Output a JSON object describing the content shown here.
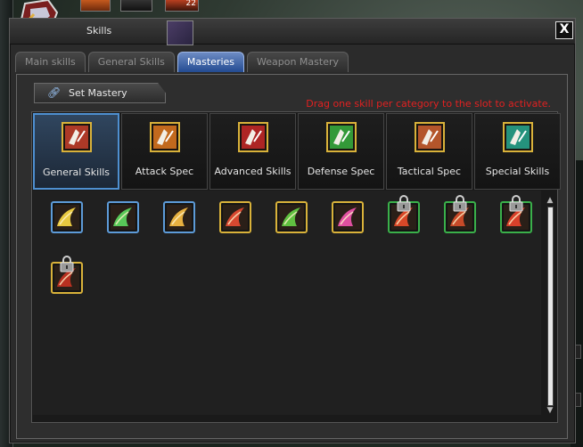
{
  "window": {
    "title": "Skills",
    "close_label": "X"
  },
  "hud": {
    "slot_badge": "22"
  },
  "tabs": [
    {
      "label": "Main skills",
      "active": false
    },
    {
      "label": "General Skills",
      "active": false
    },
    {
      "label": "Masteries",
      "active": true
    },
    {
      "label": "Weapon Mastery",
      "active": false
    }
  ],
  "panel": {
    "heading": "Set Mastery",
    "hint": "Drag one skill per category to the slot to activate."
  },
  "categories": [
    {
      "label": "General Skills",
      "active": true,
      "icon": "white-red-claw",
      "color": "#c8402c"
    },
    {
      "label": "Attack Spec",
      "active": false,
      "icon": "orange-fire-slash",
      "color": "#e07820"
    },
    {
      "label": "Advanced Skills",
      "active": false,
      "icon": "red-blade",
      "color": "#c82828"
    },
    {
      "label": "Defense Spec",
      "active": false,
      "icon": "green-swirl",
      "color": "#38b040"
    },
    {
      "label": "Tactical Spec",
      "active": false,
      "icon": "armored-figure",
      "color": "#d06030"
    },
    {
      "label": "Special Skills",
      "active": false,
      "icon": "teal-aura",
      "color": "#28a890"
    }
  ],
  "skills": [
    {
      "icon": "yellow-wing",
      "color": "#e8c840",
      "border": "blue",
      "locked": false
    },
    {
      "icon": "green-wing",
      "color": "#58c858",
      "border": "blue",
      "locked": false
    },
    {
      "icon": "golden-burst",
      "color": "#e8b040",
      "border": "blue",
      "locked": false
    },
    {
      "icon": "red-white-claw",
      "color": "#d84830",
      "border": "gold",
      "locked": false
    },
    {
      "icon": "green-white-claw",
      "color": "#60c040",
      "border": "gold",
      "locked": false
    },
    {
      "icon": "pink-star-burst",
      "color": "#e050a0",
      "border": "gold",
      "locked": false
    },
    {
      "icon": "red-flame",
      "color": "#d84828",
      "border": "green",
      "locked": true
    },
    {
      "icon": "red-flame",
      "color": "#c84a28",
      "border": "green",
      "locked": true
    },
    {
      "icon": "red-flame",
      "color": "#d8402a",
      "border": "green",
      "locked": true
    },
    {
      "icon": "dark-red-slash",
      "color": "#b83020",
      "border": "gold",
      "locked": true
    }
  ]
}
